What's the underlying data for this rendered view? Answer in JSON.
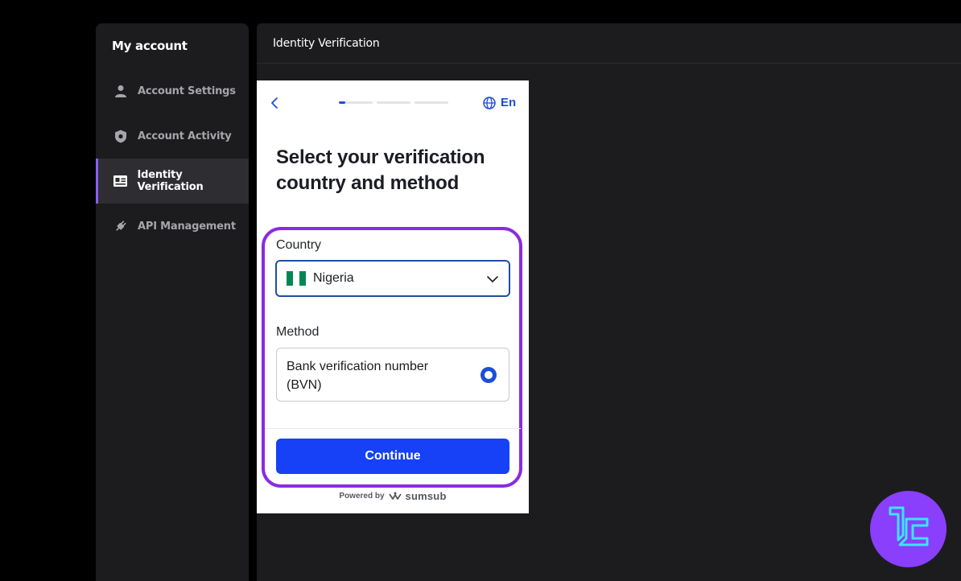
{
  "sidebar": {
    "title": "My account",
    "items": [
      {
        "label": "Account Settings",
        "icon": "user-icon"
      },
      {
        "label": "Account Activity",
        "icon": "shield-icon"
      },
      {
        "label": "Identity Verification",
        "icon": "id-card-icon",
        "active": true
      },
      {
        "label": "API Management",
        "icon": "plug-icon"
      }
    ]
  },
  "main": {
    "header_title": "Identity Verification"
  },
  "widget": {
    "language": "En",
    "progress": {
      "steps": 3,
      "current": 1,
      "current_fill": 0.2
    },
    "headline": "Select your verification country and method",
    "country_label": "Country",
    "country_value": "Nigeria",
    "method_label": "Method",
    "method_option": "Bank verification number (BVN)",
    "method_selected": true,
    "continue_label": "Continue",
    "powered_by": "Powered by",
    "brand": "sumsub"
  },
  "colors": {
    "accent_purple": "#8a2be2",
    "primary_blue": "#1641f7",
    "nigeria_green": "#008751"
  }
}
